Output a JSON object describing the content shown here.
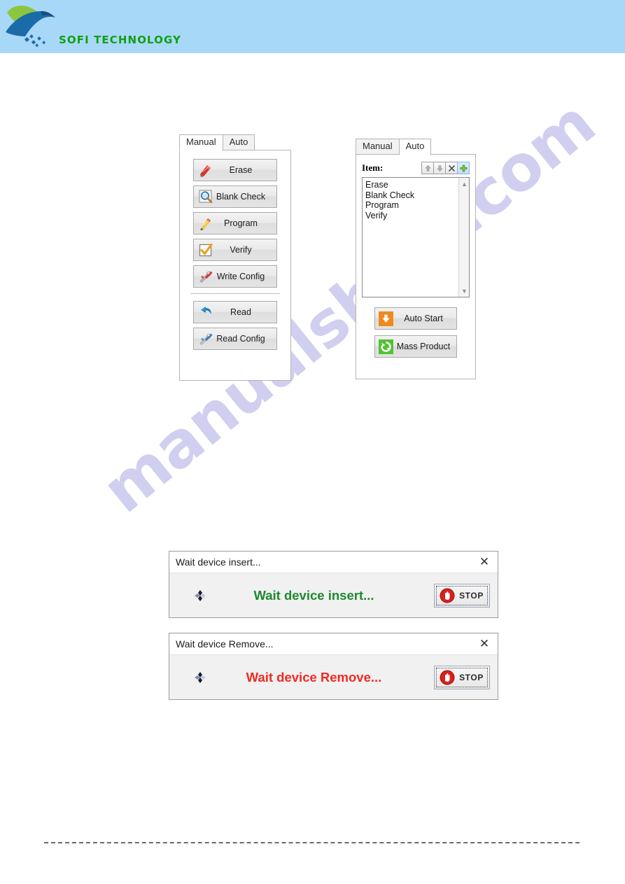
{
  "header": {
    "brand": "SOFI TECHNOLOGY",
    "logo_icon": "bird-logo",
    "bg_color": "#a8d8f8",
    "brand_color": "#11a011"
  },
  "watermark": {
    "text": "manualshive.com",
    "color": "#c9c7ee"
  },
  "manual_panel": {
    "tabs": [
      {
        "label": "Manual",
        "active": true
      },
      {
        "label": "Auto",
        "active": false
      }
    ],
    "primary_buttons": [
      {
        "label": "Erase",
        "icon": "eraser-icon"
      },
      {
        "label": "Blank Check",
        "icon": "magnifier-icon"
      },
      {
        "label": "Program",
        "icon": "pencil-icon"
      },
      {
        "label": "Verify",
        "icon": "checkbox-check-icon"
      },
      {
        "label": "Write Config",
        "icon": "tools-icon"
      }
    ],
    "secondary_buttons": [
      {
        "label": "Read",
        "icon": "undo-arrow-icon"
      },
      {
        "label": "Read Config",
        "icon": "tools-gray-icon"
      }
    ]
  },
  "auto_panel": {
    "tabs": [
      {
        "label": "Manual",
        "active": false
      },
      {
        "label": "Auto",
        "active": true
      }
    ],
    "item_label": "Item:",
    "toolbar": [
      {
        "name": "move-up",
        "icon": "arrow-up-icon",
        "selected": false
      },
      {
        "name": "move-down",
        "icon": "arrow-down-icon",
        "selected": false
      },
      {
        "name": "remove",
        "icon": "x-icon",
        "selected": false
      },
      {
        "name": "add",
        "icon": "plus-icon",
        "selected": true
      }
    ],
    "list_items": [
      "Erase",
      "Blank Check",
      "Program",
      "Verify"
    ],
    "action_buttons": [
      {
        "label": "Auto Start",
        "icon": "download-arrow-icon",
        "accent": "#f08a1e"
      },
      {
        "label": "Mass Product",
        "icon": "refresh-icon",
        "accent": "#52c234"
      }
    ]
  },
  "dialogs": [
    {
      "title": "Wait device insert...",
      "message": "Wait device insert...",
      "message_color": "#1d8a2e",
      "spinner_icon": "busy-spinner-icon",
      "close_icon": "close-icon",
      "button": {
        "label": "STOP",
        "icon": "stop-hand-icon"
      }
    },
    {
      "title": "Wait device Remove...",
      "message": "Wait device Remove...",
      "message_color": "#ee2b22",
      "spinner_icon": "busy-spinner-icon",
      "close_icon": "close-icon",
      "button": {
        "label": "STOP",
        "icon": "stop-hand-icon"
      }
    }
  ]
}
